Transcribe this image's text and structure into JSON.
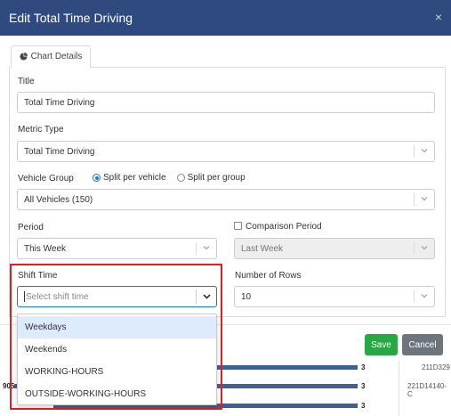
{
  "modal": {
    "title": "Edit Total Time Driving",
    "close_glyph": "×"
  },
  "tabs": [
    {
      "label": "Chart Details",
      "icon": "pie-chart-icon",
      "active": true
    }
  ],
  "form": {
    "title_label": "Title",
    "title_value": "Total Time Driving",
    "metric_label": "Metric Type",
    "metric_value": "Total Time Driving",
    "vehicle_group_label": "Vehicle Group",
    "radio_split_vehicle": "Split per vehicle",
    "radio_split_group": "Split per group",
    "radio_selected": "Split per vehicle",
    "vehicle_group_value": "All Vehicles (150)",
    "period_label": "Period",
    "period_value": "This Week",
    "comparison_label": "Comparison Period",
    "comparison_checked": false,
    "comparison_value": "Last Week",
    "shift_label": "Shift Time",
    "shift_placeholder": "Select shift time",
    "rows_label": "Number of Rows",
    "rows_value": "10"
  },
  "shift_options": [
    "Weekdays",
    "Weekends",
    "WORKING-HOURS",
    "OUTSIDE-WORKING-HOURS"
  ],
  "shift_option_highlighted": "Weekdays",
  "footer": {
    "save_label": "Save",
    "cancel_label": "Cancel"
  },
  "background": {
    "rows": [
      {
        "left_value": "",
        "count": "3",
        "id": "211D329"
      },
      {
        "left_value": "905",
        "count": "3",
        "id": "221D14140-C"
      },
      {
        "left_value": "",
        "count": "3",
        "id": ""
      }
    ]
  },
  "colors": {
    "header": "#2e4a7e",
    "save": "#28a745",
    "cancel": "#6c757d",
    "highlight": "#e01e24",
    "focus": "#1a73e8",
    "option_hover": "#deebff"
  }
}
